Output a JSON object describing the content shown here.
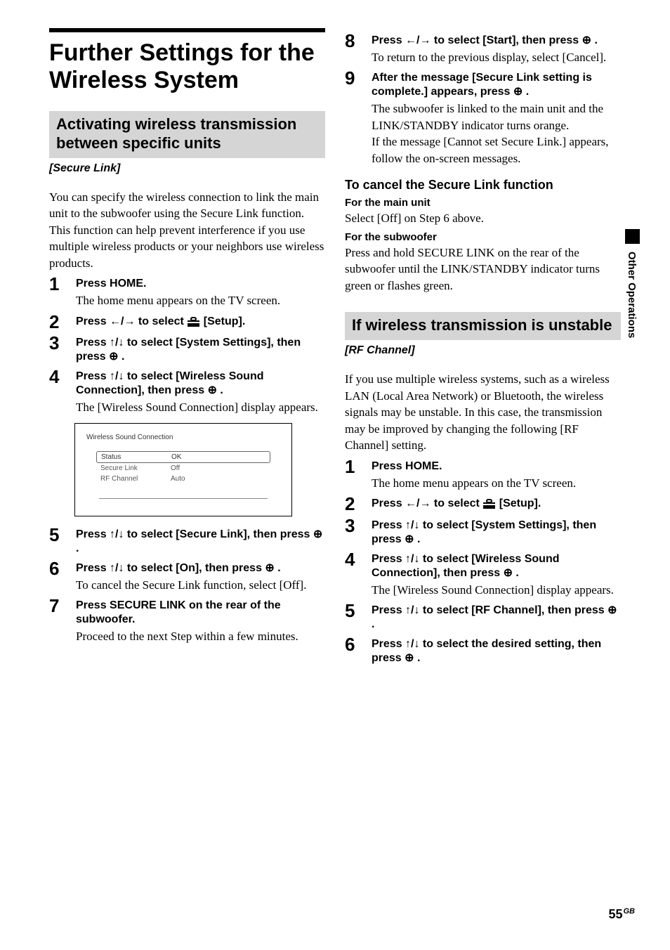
{
  "mainTitle": "Further Settings for the Wireless System",
  "section1": {
    "header": "Activating wireless transmission between specific units",
    "sub": "[Secure Link]",
    "intro": "You can specify the wireless connection to link the main unit to the subwoofer using the Secure Link function.\nThis function can help prevent interference if you use multiple wireless products or your neighbors use wireless products.",
    "steps": [
      {
        "n": "1",
        "title": "Press HOME.",
        "note": "The home menu appears on the TV screen."
      },
      {
        "n": "2",
        "titleBefore": "Press ←/→ to select ",
        "titleAfter": " [Setup]."
      },
      {
        "n": "3",
        "title": "Press ↑/↓ to select [System Settings], then press ⊕ ."
      },
      {
        "n": "4",
        "title": "Press ↑/↓ to select [Wireless Sound Connection], then press ⊕ .",
        "note": "The [Wireless Sound Connection] display appears."
      },
      {
        "n": "5",
        "title": "Press ↑/↓ to select [Secure Link], then press ⊕ ."
      },
      {
        "n": "6",
        "title": "Press ↑/↓ to select [On], then press ⊕ .",
        "note": "To cancel the Secure Link function, select [Off]."
      },
      {
        "n": "7",
        "title": "Press SECURE LINK on the rear of the subwoofer.",
        "note": "Proceed to the next Step within a few minutes."
      },
      {
        "n": "8",
        "title": "Press ←/→ to select [Start], then press ⊕ .",
        "note": "To return to the previous display, select [Cancel]."
      },
      {
        "n": "9",
        "title": "After the message [Secure Link setting is complete.] appears, press ⊕ .",
        "note": "The subwoofer is linked to the main unit and the LINK/STANDBY indicator turns orange.\nIf the message [Cannot set Secure Link.] appears, follow the on-screen messages."
      }
    ],
    "cancel": {
      "heading": "To cancel the Secure Link function",
      "mainUnitTitle": "For the main unit",
      "mainUnitText": "Select [Off] on Step 6 above.",
      "subwooferTitle": "For the subwoofer",
      "subwooferText": "Press and hold SECURE LINK on the rear of the subwoofer until the LINK/STANDBY indicator turns green or flashes green."
    }
  },
  "screenshot": {
    "title": "Wireless Sound Connection",
    "rows": [
      {
        "key": "Status",
        "val": "OK",
        "active": true
      },
      {
        "key": "Secure Link",
        "val": "Off"
      },
      {
        "key": "RF Channel",
        "val": "Auto"
      }
    ]
  },
  "section2": {
    "header": "If wireless transmission is unstable",
    "sub": "[RF Channel]",
    "intro": "If you use multiple wireless systems, such as a wireless LAN (Local Area Network) or Bluetooth, the wireless signals may be unstable. In this case, the transmission may be improved by changing the following [RF Channel] setting.",
    "steps": [
      {
        "n": "1",
        "title": "Press HOME.",
        "note": "The home menu appears on the TV screen."
      },
      {
        "n": "2",
        "titleBefore": "Press ←/→ to select ",
        "titleAfter": " [Setup]."
      },
      {
        "n": "3",
        "title": "Press ↑/↓ to select [System Settings], then press ⊕ ."
      },
      {
        "n": "4",
        "title": "Press ↑/↓ to select [Wireless Sound Connection], then press ⊕ .",
        "note": "The [Wireless Sound Connection] display appears."
      },
      {
        "n": "5",
        "title": "Press ↑/↓ to select [RF Channel], then press ⊕ ."
      },
      {
        "n": "6",
        "title": "Press ↑/↓ to select the desired setting, then press ⊕ ."
      }
    ]
  },
  "sideTab": "Other Operations",
  "footer": {
    "page": "55",
    "region": "GB"
  }
}
